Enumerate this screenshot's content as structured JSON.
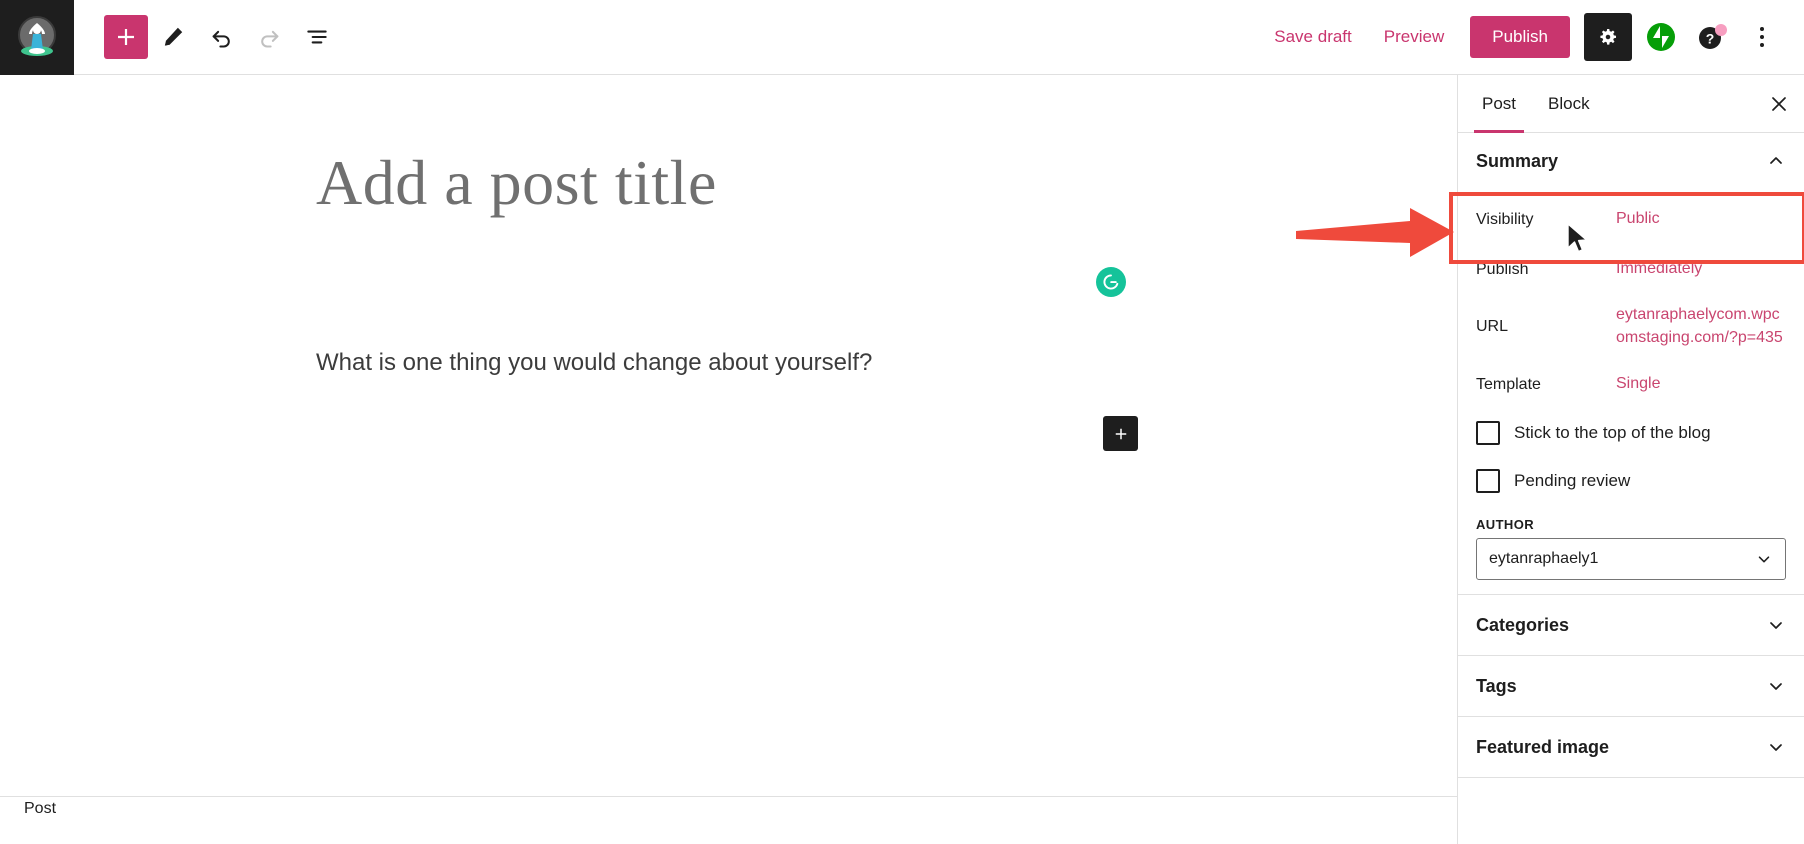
{
  "app": {
    "name": "WordPress Block Editor",
    "accent_pink": "#c9356e",
    "link_pink": "#c9456f",
    "annotation_red": "#ef4a3c",
    "dark": "#1e1e1e"
  },
  "toolbar": {
    "logo_icon": "yoga-meditation-logo",
    "add_block_label": "+",
    "add_block_icon": "plus-icon",
    "tools_icon": "pencil-icon",
    "undo_icon": "undo-arrow-icon",
    "redo_icon": "redo-arrow-icon",
    "list_view_icon": "list-view-icon",
    "save_draft_label": "Save draft",
    "preview_label": "Preview",
    "publish_label": "Publish",
    "settings_icon": "gear-icon",
    "jetpack_icon": "jetpack-icon",
    "help_icon": "help-question-icon",
    "help_badge": "notification-dot",
    "more_icon": "kebab-menu-icon"
  },
  "editor": {
    "title_placeholder": "Add a post title",
    "body_text": "What is one thing you would change about yourself?",
    "grammarly_icon": "grammarly-icon",
    "inserter_icon": "plus-icon"
  },
  "bottom_bar": {
    "breadcrumb": "Post"
  },
  "sidebar": {
    "tabs": [
      {
        "label": "Post",
        "active": true
      },
      {
        "label": "Block",
        "active": false
      }
    ],
    "close_icon": "close-icon",
    "summary": {
      "title": "Summary",
      "collapse_icon": "chevron-up-icon",
      "rows": [
        {
          "label": "Visibility",
          "value": "Public"
        },
        {
          "label": "Publish",
          "value": "Immediately"
        },
        {
          "label": "URL",
          "value": "eytanraphaelycom.wpcomstaging.com/?p=435"
        },
        {
          "label": "Template",
          "value": "Single"
        }
      ],
      "checkboxes": [
        {
          "label": "Stick to the top of the blog",
          "checked": false
        },
        {
          "label": "Pending review",
          "checked": false
        }
      ],
      "author_label": "AUTHOR",
      "author_value": "eytanraphaely1",
      "author_chevron": "chevron-down-icon"
    },
    "panels": [
      {
        "label": "Categories",
        "expand_icon": "chevron-down-icon"
      },
      {
        "label": "Tags",
        "expand_icon": "chevron-down-icon"
      },
      {
        "label": "Featured image",
        "expand_icon": "chevron-down-icon"
      }
    ]
  },
  "annotations": {
    "highlight_target": "Visibility",
    "arrow_icon": "right-arrow-annotation",
    "box_icon": "rectangle-highlight",
    "cursor_icon": "mouse-pointer-icon"
  }
}
